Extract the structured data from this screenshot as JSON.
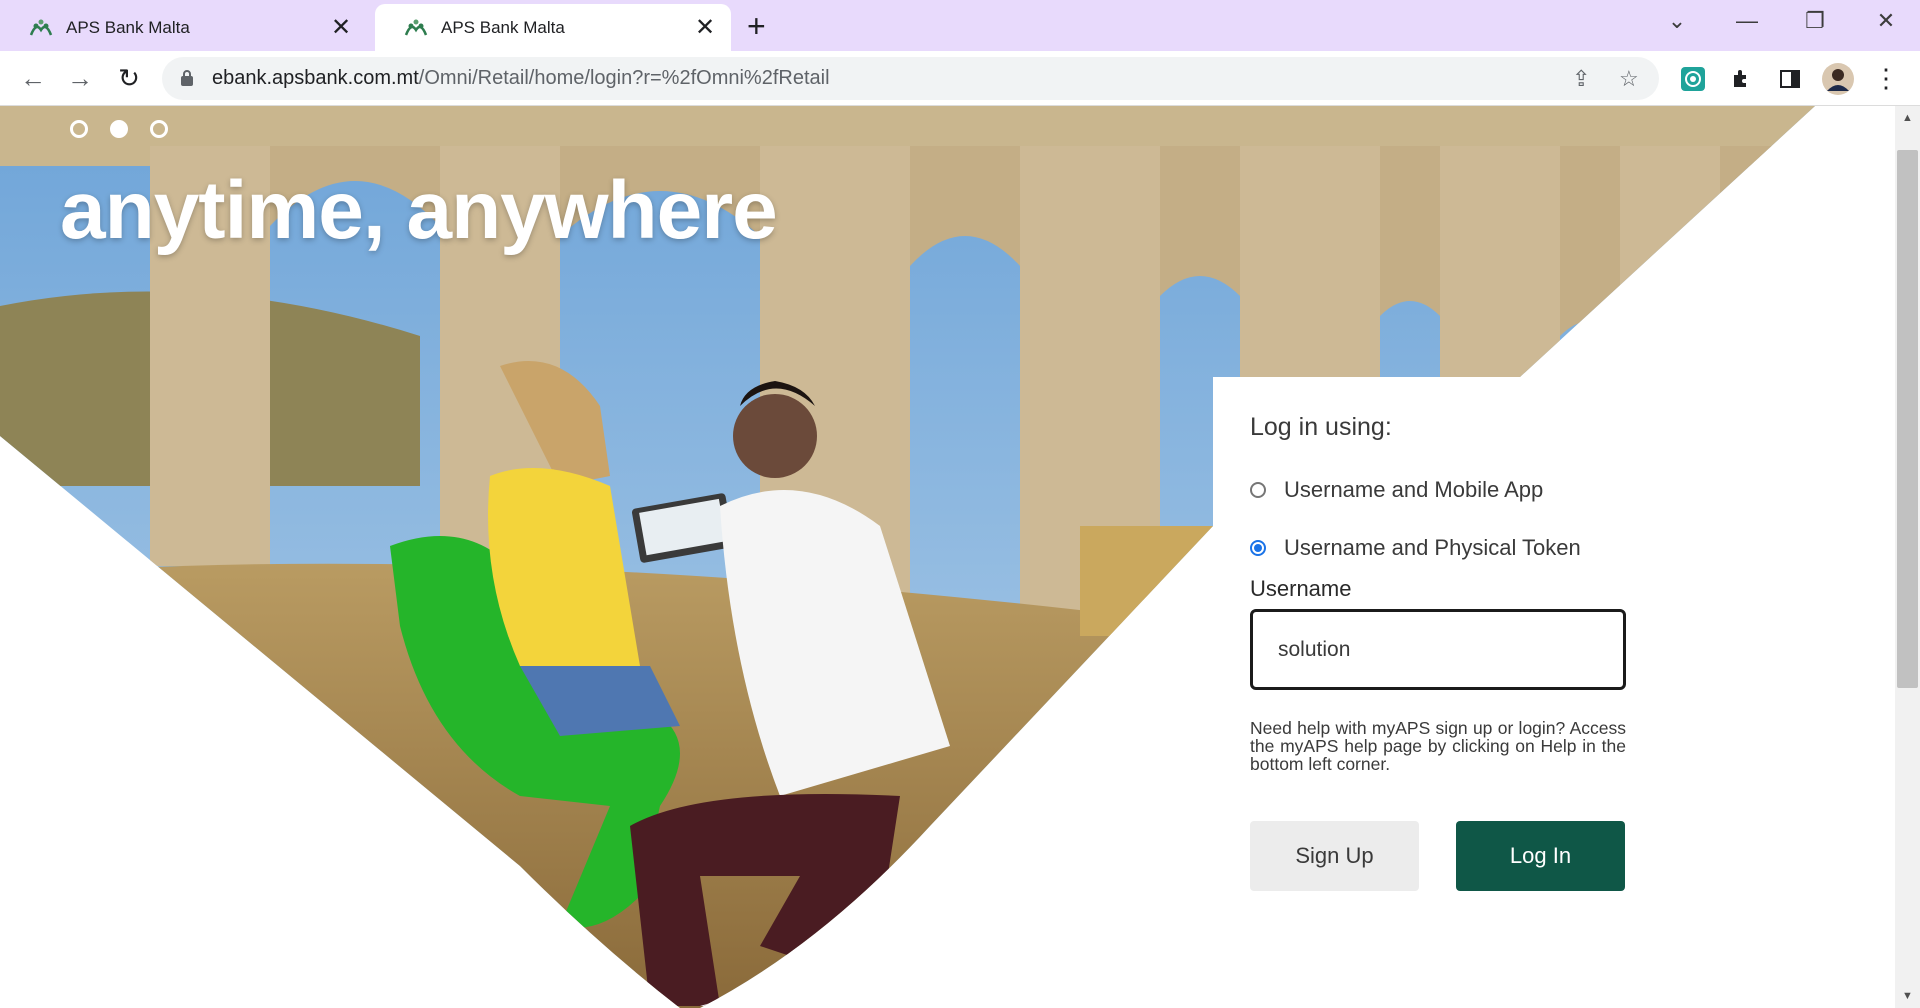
{
  "browser": {
    "tabs": [
      {
        "title": "APS Bank Malta",
        "active": false
      },
      {
        "title": "APS Bank Malta",
        "active": true
      }
    ],
    "new_tab_icon": "plus-icon",
    "url_host": "ebank.apsbank.com.mt",
    "url_path": "/Omni/Retail/home/login?r=%2fOmni%2fRetail",
    "colors": {
      "tab_strip": "#e8dafc",
      "omnibox": "#f1f3f4"
    }
  },
  "hero": {
    "headline": "anytime, anywhere",
    "carousel": {
      "count": 3,
      "active_index": 1
    }
  },
  "login": {
    "heading": "Log in using:",
    "options": [
      {
        "label": "Username and Mobile App",
        "checked": false
      },
      {
        "label": "Username and Physical Token",
        "checked": true
      }
    ],
    "username_label": "Username",
    "username_value": "solution",
    "help_text": "Need help with myAPS sign up or login? Access the myAPS help page by clicking on Help in the bottom left corner.",
    "signup_label": "Sign Up",
    "login_label": "Log In",
    "colors": {
      "login_button": "#0f5747",
      "signup_button": "#ececec"
    }
  }
}
